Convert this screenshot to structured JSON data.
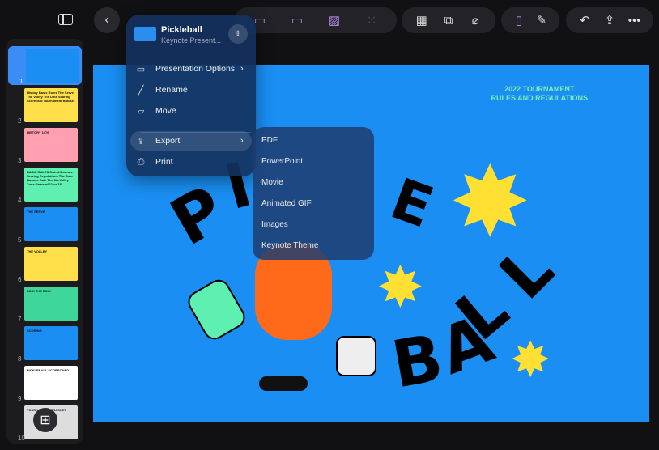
{
  "toolbar": {
    "sidebar_icon": "sidebar-icon",
    "back_icon": "chevron-left-icon",
    "insert_icons": [
      "text-box-sparkle-icon",
      "media-sparkle-icon",
      "image-sparkle-icon",
      "grid-icon"
    ],
    "object_icons": [
      "table-chart-icon",
      "shapes-icon",
      "paperclip-icon"
    ],
    "format_icons": [
      "layers-icon",
      "paintbrush-icon"
    ],
    "action_icons": [
      "undo-icon",
      "share-icon",
      "more-icon"
    ],
    "accent": "#b98cf0"
  },
  "sidebar": {
    "slides": [
      {
        "num": "1",
        "color": "#1a8ef2",
        "text": ""
      },
      {
        "num": "2",
        "color": "#ffe04a",
        "text": "History Basic Rules The Serve The Volley The Dink Scoring Scorecard Tournament Bracket"
      },
      {
        "num": "3",
        "color": "#ff9fb0",
        "text": "HISTORY 1976"
      },
      {
        "num": "4",
        "color": "#5ef0b0",
        "text": "BASIC RULES Out-of-Bounds Serving Regulations The Two-Bounce Rule The No-Volley Zone Game of 11 or 15"
      },
      {
        "num": "5",
        "color": "#1a8ef2",
        "text": "THE SERVE"
      },
      {
        "num": "6",
        "color": "#ffe04a",
        "text": "THE VOLLEY"
      },
      {
        "num": "7",
        "color": "#3ed69a",
        "text": "DINK THE DINK"
      },
      {
        "num": "8",
        "color": "#1a8ef2",
        "text": "SCORING"
      },
      {
        "num": "9",
        "color": "#ffffff",
        "text": "PICKLEBALL SCORECARD"
      },
      {
        "num": "10",
        "color": "#dddddd",
        "text": "TOURNAMENT BRACKET"
      }
    ],
    "selected": 1,
    "add_icon": "plus-square-icon"
  },
  "slide": {
    "subtitle_line1": "2022 TOURNAMENT",
    "subtitle_line2": "RULES AND REGULATIONS",
    "logo_letters": "PICKLE BALL",
    "bg": "#1a8ef2"
  },
  "menu": {
    "title": "Pickleball",
    "subtitle": "Keynote Present...",
    "items": [
      {
        "label": "Presentation Options",
        "icon": "screen-icon",
        "has_submenu": true
      },
      {
        "label": "Rename",
        "icon": "pencil-icon"
      },
      {
        "label": "Move",
        "icon": "folder-icon"
      },
      {
        "label": "Export",
        "icon": "export-icon",
        "has_submenu": true,
        "highlighted": true
      },
      {
        "label": "Print",
        "icon": "printer-icon"
      }
    ]
  },
  "export_submenu": [
    "PDF",
    "PowerPoint",
    "Movie",
    "Animated GIF",
    "Images",
    "Keynote Theme"
  ]
}
